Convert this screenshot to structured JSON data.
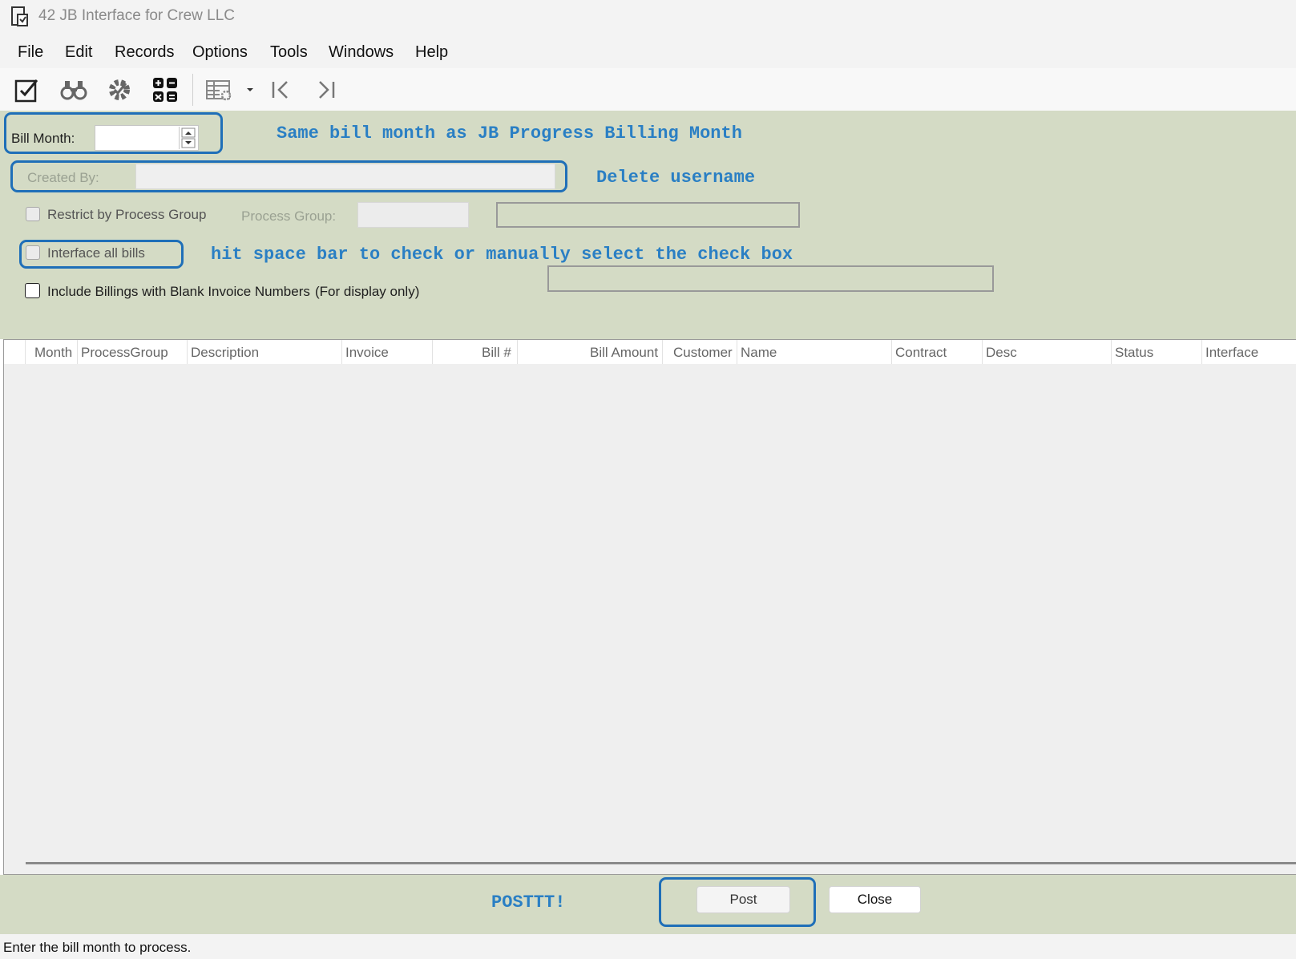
{
  "window": {
    "title": "42 JB Interface for Crew LLC",
    "icon": "report-icon"
  },
  "menu": [
    "File",
    "Edit",
    "Records",
    "Options",
    "Tools",
    "Windows",
    "Help"
  ],
  "toolbar": {
    "icons": [
      "edit-check-icon",
      "binoculars-icon",
      "gear-icon",
      "calculator-icon",
      "grid-settings-icon",
      "dropdown-arrow-icon",
      "first-record-icon",
      "last-record-icon"
    ]
  },
  "form": {
    "bill_month_label": "Bill Month:",
    "bill_month_value": "",
    "created_by_label": "Created By:",
    "created_by_value": "",
    "restrict_label": "Restrict by Process Group",
    "restrict_checked": false,
    "process_group_label": "Process Group:",
    "process_group_value": "",
    "interface_all_label": "Interface all bills",
    "interface_all_checked": false,
    "include_blank_label": "Include Billings with Blank Invoice Numbers",
    "include_blank_note": "(For display only)",
    "include_blank_checked": false
  },
  "annotations": {
    "bill_month": "Same bill month as JB Progress Billing Month",
    "created_by": "Delete username",
    "interface_all": "hit space bar to check or manually select the check box",
    "post": "POSTTT!"
  },
  "grid": {
    "columns": [
      "Month",
      "ProcessGroup",
      "Description",
      "Invoice",
      "Bill #",
      "Bill Amount",
      "Customer",
      "Name",
      "Contract",
      "Desc",
      "Status",
      "Interface"
    ],
    "rows": []
  },
  "buttons": {
    "post": "Post",
    "close": "Close"
  },
  "status_bar": "Enter the bill month to process.",
  "colors": {
    "form_background": "#d4dbc5",
    "annotation": "#2a7fc4",
    "highlight_border": "#1f6fb8"
  }
}
